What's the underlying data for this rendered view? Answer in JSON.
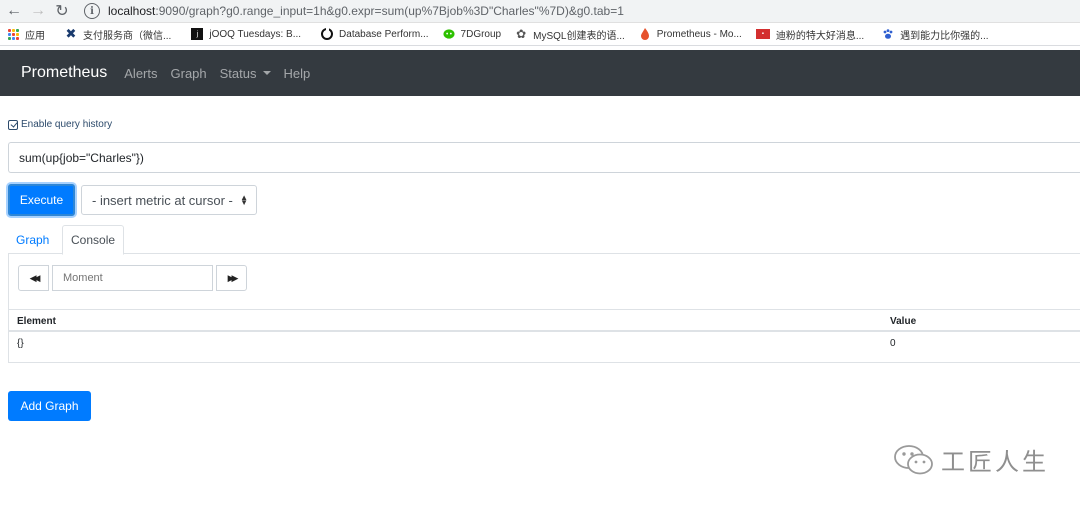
{
  "browser": {
    "url_host": "localhost",
    "url_rest": ":9090/graph?g0.range_input=1h&g0.expr=sum(up%7Bjob%3D\"Charles\"%7D)&g0.tab=1",
    "bookmarks": [
      {
        "label": "应用",
        "icon": "apps-grid-icon"
      },
      {
        "label": "支付服务商（微信...",
        "icon": "x-logo-icon"
      },
      {
        "label": "jOOQ Tuesdays: B...",
        "icon": "jooq-icon"
      },
      {
        "label": "Database Perform...",
        "icon": "db-icon"
      },
      {
        "label": "7DGroup",
        "icon": "wechat-icon"
      },
      {
        "label": "MySQL创建表的语...",
        "icon": "mysql-icon"
      },
      {
        "label": "Prometheus - Mo...",
        "icon": "prometheus-icon"
      },
      {
        "label": "迪粉的特大好消息...",
        "icon": "news-icon"
      },
      {
        "label": "遇到能力比你强的...",
        "icon": "baidu-paw-icon"
      }
    ]
  },
  "navbar": {
    "brand": "Prometheus",
    "links": [
      "Alerts",
      "Graph",
      "Status",
      "Help"
    ]
  },
  "query": {
    "history_label": "Enable query history",
    "expression": "sum(up{job=\"Charles\"})",
    "execute_label": "Execute",
    "metric_select": "- insert metric at cursor -"
  },
  "tabs": [
    "Graph",
    "Console"
  ],
  "console": {
    "moment_placeholder": "Moment",
    "columns": [
      "Element",
      "Value"
    ],
    "rows": [
      {
        "element": "{}",
        "value": "0"
      }
    ]
  },
  "add_graph_label": "Add Graph",
  "watermark": {
    "text": "工匠人生"
  },
  "colors": {
    "navbar": "#343a40",
    "primary": "#007bff"
  }
}
